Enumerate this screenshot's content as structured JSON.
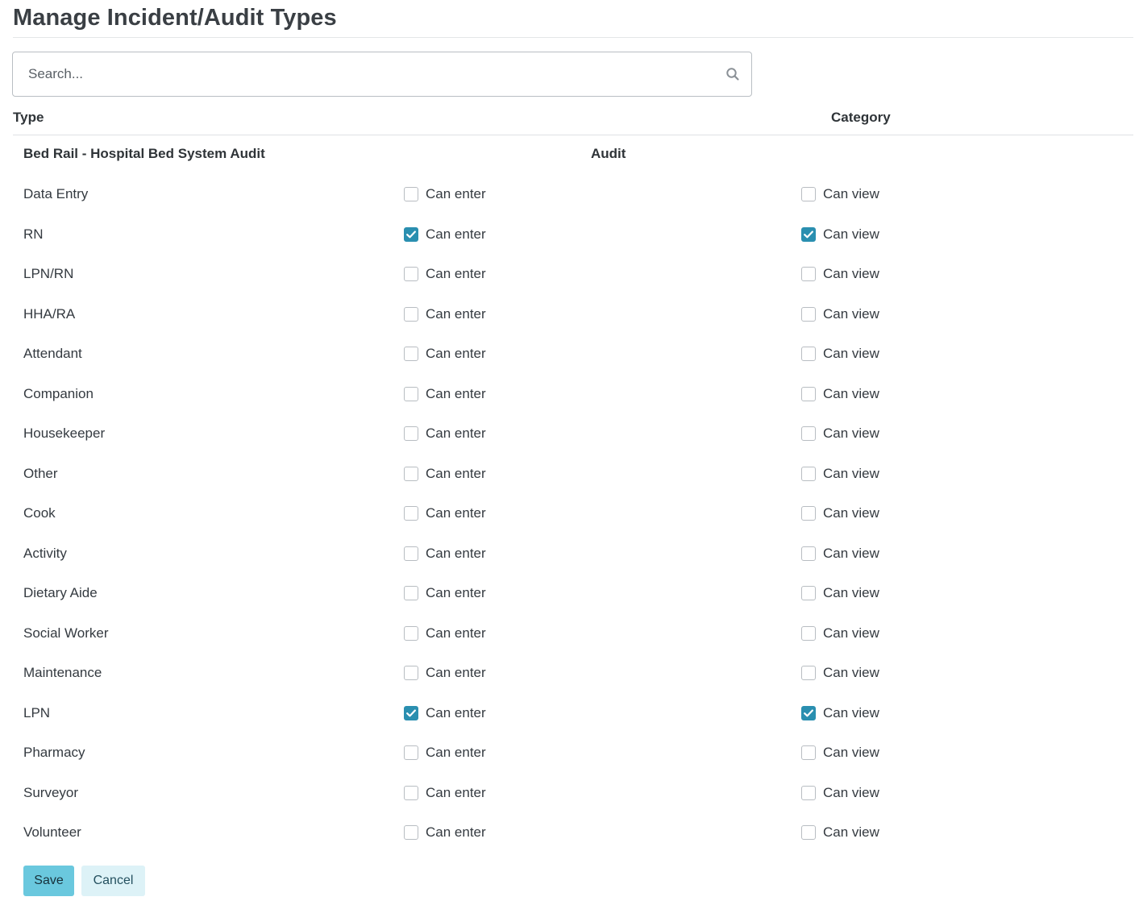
{
  "page": {
    "title": "Manage Incident/Audit Types"
  },
  "search": {
    "placeholder": "Search...",
    "value": ""
  },
  "table": {
    "headers": {
      "type": "Type",
      "category": "Category"
    },
    "group": {
      "name": "Bed Rail - Hospital Bed System Audit",
      "category": "Audit"
    },
    "enter_label": "Can enter",
    "view_label": "Can view",
    "rows": [
      {
        "label": "Data Entry",
        "can_enter": false,
        "can_view": false
      },
      {
        "label": "RN",
        "can_enter": true,
        "can_view": true
      },
      {
        "label": "LPN/RN",
        "can_enter": false,
        "can_view": false
      },
      {
        "label": "HHA/RA",
        "can_enter": false,
        "can_view": false
      },
      {
        "label": "Attendant",
        "can_enter": false,
        "can_view": false
      },
      {
        "label": "Companion",
        "can_enter": false,
        "can_view": false
      },
      {
        "label": "Housekeeper",
        "can_enter": false,
        "can_view": false
      },
      {
        "label": "Other",
        "can_enter": false,
        "can_view": false
      },
      {
        "label": "Cook",
        "can_enter": false,
        "can_view": false
      },
      {
        "label": "Activity",
        "can_enter": false,
        "can_view": false
      },
      {
        "label": "Dietary Aide",
        "can_enter": false,
        "can_view": false
      },
      {
        "label": "Social Worker",
        "can_enter": false,
        "can_view": false
      },
      {
        "label": "Maintenance",
        "can_enter": false,
        "can_view": false
      },
      {
        "label": "LPN",
        "can_enter": true,
        "can_view": true
      },
      {
        "label": "Pharmacy",
        "can_enter": false,
        "can_view": false
      },
      {
        "label": "Surveyor",
        "can_enter": false,
        "can_view": false
      },
      {
        "label": "Volunteer",
        "can_enter": false,
        "can_view": false
      }
    ]
  },
  "actions": {
    "save_label": "Save",
    "cancel_label": "Cancel"
  },
  "colors": {
    "accent": "#2a8fb0",
    "save_button": "#6ac8de",
    "cancel_button": "#ddf2f7"
  },
  "icons": {
    "search": "search-icon",
    "check": "check-icon"
  }
}
